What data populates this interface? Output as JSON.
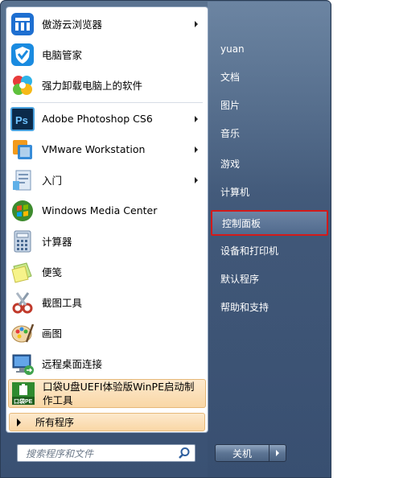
{
  "left": {
    "items": [
      {
        "label": "傲游云浏览器",
        "icon": "maxthon-browser-icon",
        "has_submenu": true
      },
      {
        "label": "电脑管家",
        "icon": "tencent-pc-manager-icon",
        "has_submenu": false
      },
      {
        "label": "强力卸载电脑上的软件",
        "icon": "uninstaller-icon",
        "has_submenu": false
      },
      {
        "label": "Adobe Photoshop CS6",
        "icon": "photoshop-icon",
        "has_submenu": true
      },
      {
        "label": "VMware Workstation",
        "icon": "vmware-icon",
        "has_submenu": true
      },
      {
        "label": "入门",
        "icon": "getting-started-icon",
        "has_submenu": true
      },
      {
        "label": "Windows Media Center",
        "icon": "media-center-icon",
        "has_submenu": false
      },
      {
        "label": "计算器",
        "icon": "calculator-icon",
        "has_submenu": false
      },
      {
        "label": "便笺",
        "icon": "sticky-notes-icon",
        "has_submenu": false
      },
      {
        "label": "截图工具",
        "icon": "snipping-tool-icon",
        "has_submenu": false
      },
      {
        "label": "画图",
        "icon": "paint-icon",
        "has_submenu": false
      },
      {
        "label": "远程桌面连接",
        "icon": "remote-desktop-icon",
        "has_submenu": false
      }
    ],
    "highlighted_item": {
      "label_line1": "口袋U盘UEFI体验版WinPE启动制",
      "label_line2": "作工具",
      "icon": "koudai-winpe-icon"
    },
    "all_programs_label": "所有程序",
    "search_placeholder": "搜索程序和文件"
  },
  "right": {
    "items": [
      {
        "label": "yuan"
      },
      {
        "label": "文档"
      },
      {
        "label": "图片"
      },
      {
        "label": "音乐"
      },
      {
        "label": "游戏"
      },
      {
        "label": "计算机"
      },
      {
        "label": "控制面板",
        "selected": true
      },
      {
        "label": "设备和打印机"
      },
      {
        "label": "默认程序"
      },
      {
        "label": "帮助和支持"
      }
    ],
    "shutdown_label": "关机"
  },
  "colors": {
    "menu_blue": "#42597a",
    "selection_border": "#d31a1a",
    "highlight_orange": "#f9d7a6"
  }
}
